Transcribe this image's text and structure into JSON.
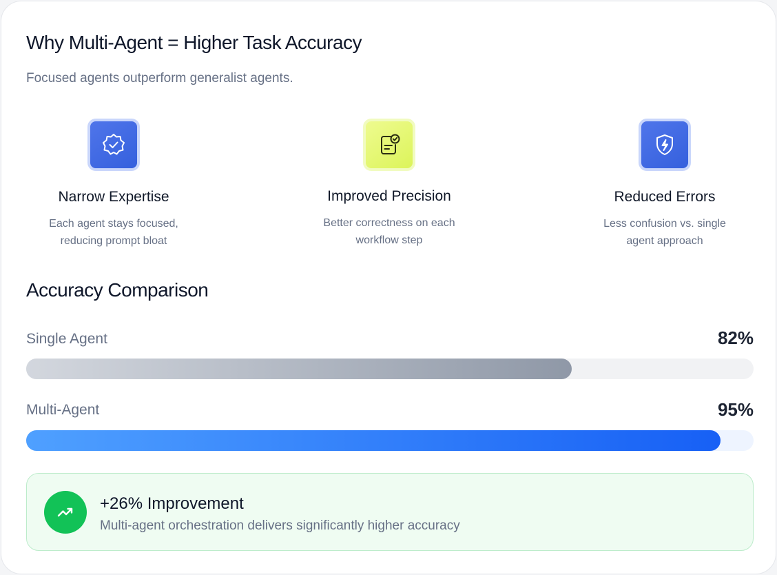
{
  "header": {
    "title": "Why Multi-Agent = Higher Task Accuracy",
    "subtitle": "Focused agents outperform generalist agents."
  },
  "features": [
    {
      "icon": "badge-check-icon",
      "title": "Narrow Expertise",
      "desc_line1": "Each agent stays focused,",
      "desc_line2": "reducing prompt bloat"
    },
    {
      "icon": "clipboard-check-icon",
      "title": "Improved Precision",
      "desc_line1": "Better correctness on each",
      "desc_line2": "workflow step"
    },
    {
      "icon": "shield-bolt-icon",
      "title": "Reduced Errors",
      "desc_line1": "Less confusion vs. single",
      "desc_line2": "agent approach"
    }
  ],
  "comparison": {
    "title": "Accuracy Comparison",
    "bars": [
      {
        "label": "Single Agent",
        "value_text": "82%",
        "fill_fraction": 0.75
      },
      {
        "label": "Multi-Agent",
        "value_text": "95%",
        "fill_fraction": 0.955
      }
    ]
  },
  "callout": {
    "icon": "trending-up-icon",
    "title": "+26% Improvement",
    "desc": "Multi-agent orchestration delivers significantly higher accuracy"
  },
  "colors": {
    "accent_blue": "#1760f5",
    "accent_lime": "#dcf45a",
    "success_green": "#12c257"
  }
}
